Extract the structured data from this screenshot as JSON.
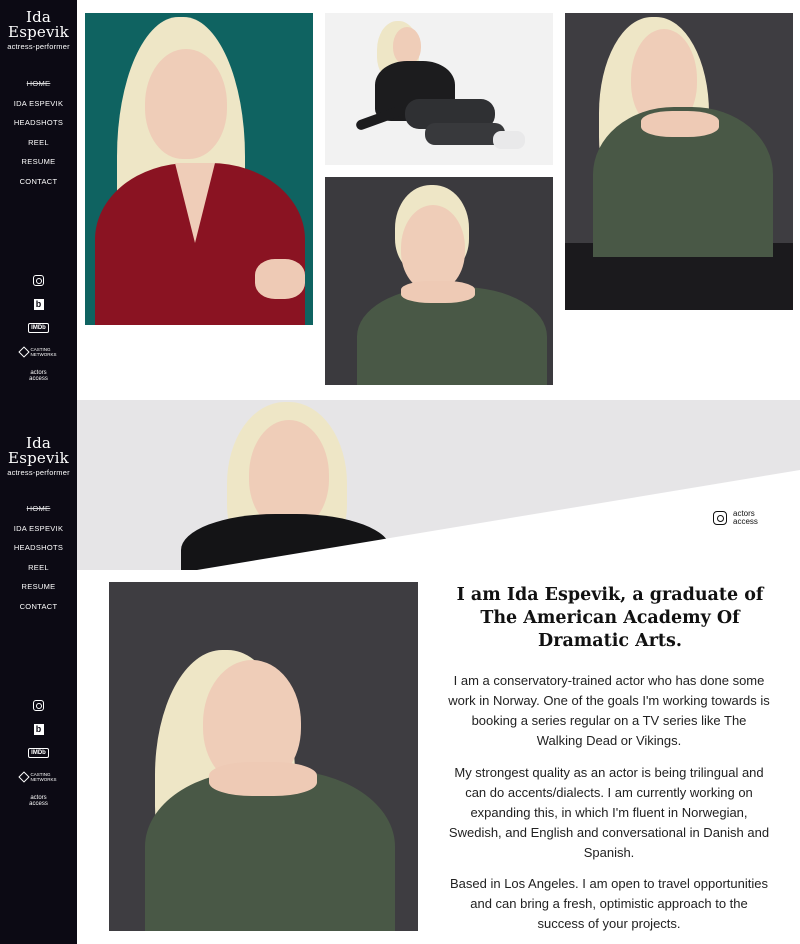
{
  "site": {
    "name_line1": "Ida",
    "name_line2": "Espevik",
    "tagline": "actress-performer"
  },
  "nav": {
    "items": [
      {
        "label": "HOME",
        "active": true
      },
      {
        "label": "IDA ESPEVIK"
      },
      {
        "label": "HEADSHOTS"
      },
      {
        "label": "REEL"
      },
      {
        "label": "RESUME"
      },
      {
        "label": "CONTACT"
      }
    ]
  },
  "social": {
    "imdb": "IMDb",
    "casting_line1": "CASTING",
    "casting_line2": "NETWORKS",
    "actors_line1": "actors",
    "actors_line2": "access"
  },
  "about": {
    "headline": "I am Ida Espevik, a graduate of The American Academy Of Dramatic Arts.",
    "paragraphs": [
      "I am a conservatory-trained actor who has done some work in Norway. One of the goals I'm working towards is booking a series regular on a TV series like The Walking Dead or Vikings.",
      "My strongest quality as an actor is being trilingual and can do accents/dialects. I am currently working on expanding this, in which I'm fluent in Norwegian, Swedish, and English and conversational in Danish and Spanish.",
      "Based in Los Angeles. I am open to travel opportunities and can bring a fresh, optimistic approach to the success of your projects."
    ]
  },
  "colors": {
    "sidebar": "#0c0a14",
    "teal_backdrop": "#0f6361",
    "red_sweater": "#8a1322",
    "green_sweater": "#495846",
    "grey_backdrop": "#3e3d41"
  }
}
